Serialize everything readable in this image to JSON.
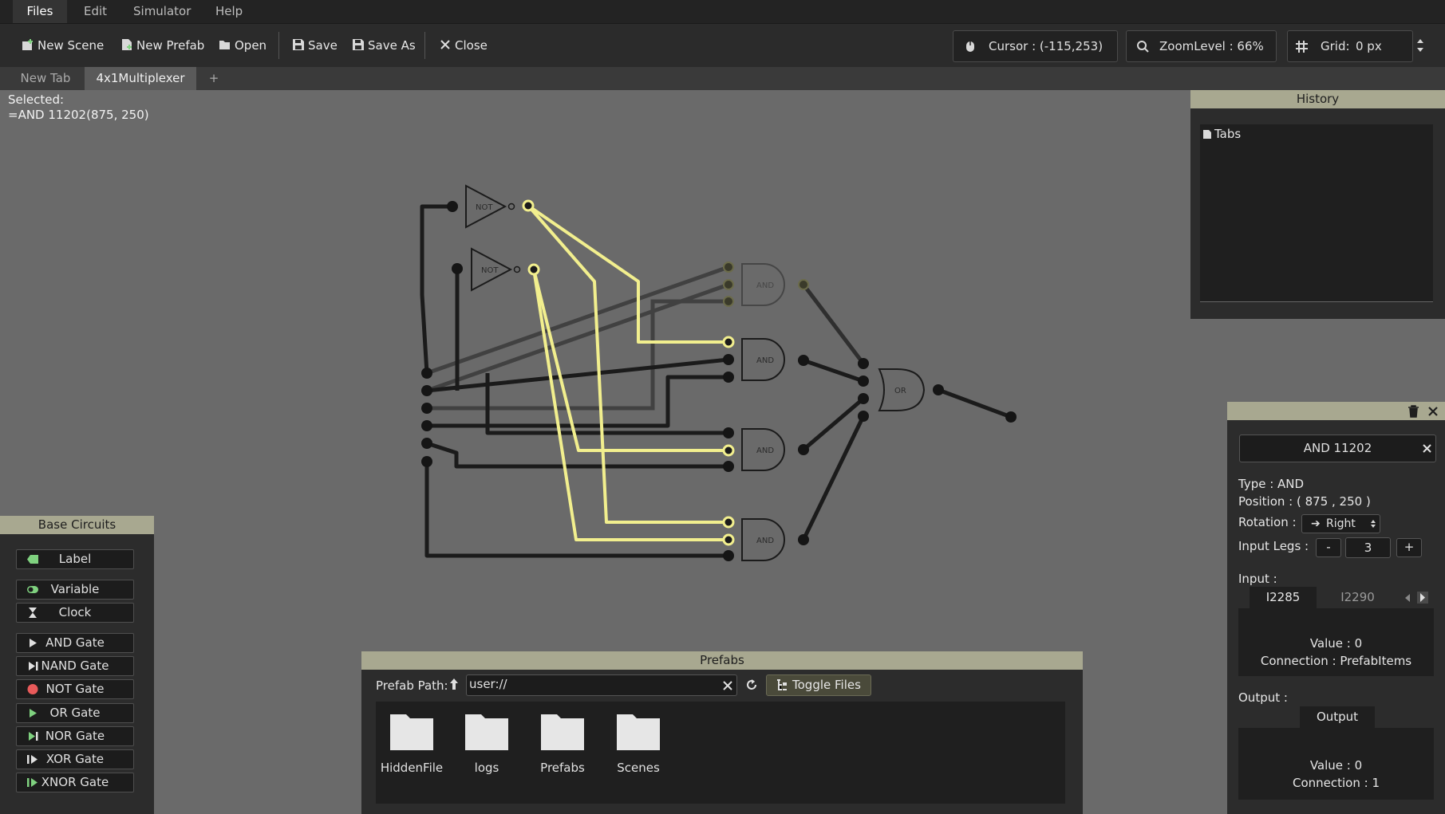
{
  "menu": [
    "Files",
    "Edit",
    "Simulator",
    "Help"
  ],
  "toolbar": {
    "new_scene": "New Scene",
    "new_prefab": "New Prefab",
    "open": "Open",
    "save": "Save",
    "save_as": "Save As",
    "close": "Close",
    "cursor": "Cursor : (-115,253)",
    "zoom": "ZoomLevel : 66%",
    "grid_label": "Grid:",
    "grid_value": "0 px"
  },
  "tabs": [
    "New Tab",
    "4x1Multiplexer",
    "+"
  ],
  "selected": {
    "label": "Selected:",
    "value": "=AND 11202(875, 250)"
  },
  "history": {
    "title": "History",
    "root": "Tabs"
  },
  "base_circuits": {
    "title": "Base Circuits",
    "items": [
      "Label",
      "Variable",
      "Clock",
      "AND Gate",
      "NAND Gate",
      "NOT Gate",
      "OR Gate",
      "NOR Gate",
      "XOR Gate",
      "XNOR Gate"
    ]
  },
  "prefabs": {
    "title": "Prefabs",
    "path_label": "Prefab Path:",
    "path_value": "user://",
    "toggle": "Toggle Files",
    "folders": [
      "HiddenFile",
      "logs",
      "Prefabs",
      "Scenes"
    ]
  },
  "props": {
    "name": "AND 11202",
    "type": "Type : AND",
    "position": "Position : ( 875 , 250 )",
    "rotation_label": "Rotation :",
    "rotation_value": "Right",
    "legs_label": "Input Legs :",
    "legs_minus": "-",
    "legs_value": "3",
    "legs_plus": "+",
    "input_label": "Input :",
    "input_tabs": [
      "I2285",
      "I2290"
    ],
    "input_value": "Value : 0",
    "input_conn": "Connection : PrefabItems",
    "output_label": "Output :",
    "output_tab": "Output",
    "output_value": "Value : 0",
    "output_conn": "Connection : 1"
  },
  "circuit": {
    "gate_labels": {
      "not": "NOT",
      "and": "AND",
      "or": "OR"
    }
  },
  "colors": {
    "accent": "#a8a890",
    "wire_active": "#f2ef8e",
    "wire": "#1b1b1b",
    "canvas": "#6a6a6a"
  }
}
